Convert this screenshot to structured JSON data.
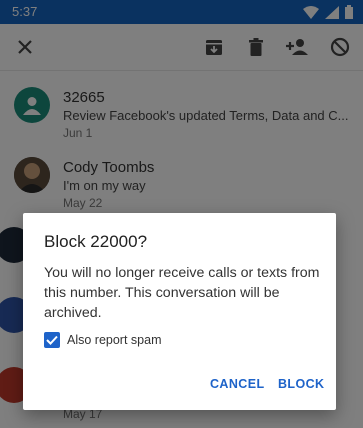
{
  "status_bar": {
    "time": "5:37"
  },
  "toolbar": {
    "close_icon": "close-icon",
    "archive_icon": "archive-icon",
    "delete_icon": "trash-icon",
    "add_contact_icon": "add-person-icon",
    "block_icon": "block-icon"
  },
  "conversations": [
    {
      "name": "32665",
      "snippet": "Review Facebook's updated Terms, Data and C...",
      "date": "Jun 1",
      "avatar_color": "#1a8c7a"
    },
    {
      "name": "Cody Toombs",
      "snippet": "I'm on my way",
      "date": "May 22",
      "avatar_color": "#3a3a3a"
    },
    {
      "name": "",
      "snippet": "",
      "date": "",
      "avatar_color": "#1e2a3a"
    },
    {
      "name": "",
      "snippet": "",
      "date": "",
      "avatar_color": "#2f55a8"
    },
    {
      "name": "",
      "snippet": "",
      "date": "May 17",
      "avatar_color": "#c0392b"
    }
  ],
  "dialog": {
    "title": "Block 22000?",
    "body": "You will no longer receive calls or texts from this number. This conversation will be archived.",
    "checkbox_label": "Also report spam",
    "checkbox_checked": true,
    "cancel_label": "CANCEL",
    "block_label": "BLOCK"
  },
  "colors": {
    "status_bar": "#1565c0",
    "accent": "#1e63c9"
  }
}
